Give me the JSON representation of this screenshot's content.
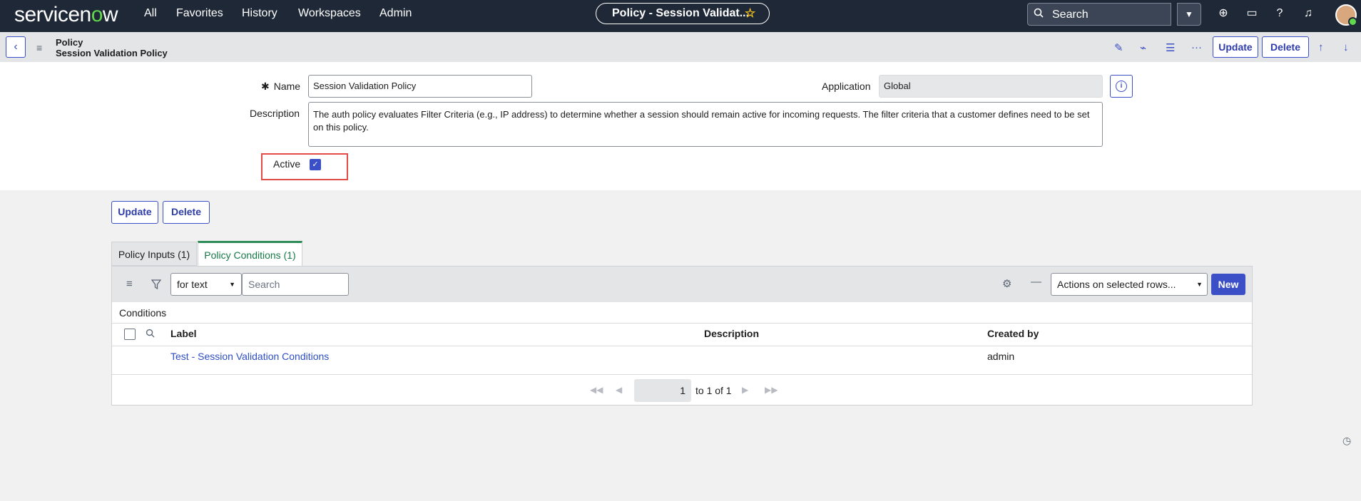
{
  "nav": {
    "logo_pre": "servicen",
    "logo_o": "o",
    "logo_post": "w",
    "links": [
      "All",
      "Favorites",
      "History",
      "Workspaces",
      "Admin"
    ],
    "page_pill": "Policy - Session Validat...",
    "search_placeholder": "Search"
  },
  "header": {
    "table": "Policy",
    "record": "Session Validation Policy",
    "update_label": "Update",
    "delete_label": "Delete"
  },
  "form": {
    "name_label": "Name",
    "name_value": "Session Validation Policy",
    "application_label": "Application",
    "application_value": "Global",
    "description_label": "Description",
    "description_value": "The auth policy evaluates Filter Criteria (e.g., IP address) to determine whether a session should remain active for incoming requests.  The filter criteria that a customer defines need to be set on this policy.",
    "active_label": "Active",
    "active_checked": true
  },
  "bottom_buttons": {
    "update": "Update",
    "delete": "Delete"
  },
  "tabs": [
    {
      "label": "Policy Inputs (1)",
      "active": false
    },
    {
      "label": "Policy Conditions (1)",
      "active": true
    }
  ],
  "list": {
    "search_field": "for text",
    "search_placeholder": "Search",
    "actions_select": "Actions on selected rows...",
    "new_label": "New",
    "title": "Conditions",
    "columns": [
      "Label",
      "Description",
      "Created by"
    ],
    "rows": [
      {
        "label": "Test - Session Validation Conditions",
        "description": "",
        "created_by": "admin"
      }
    ],
    "pager": {
      "current": "1",
      "range_text": "to 1 of 1"
    }
  },
  "colors": {
    "brand": "#1f2837",
    "accent": "#3b4fc6",
    "tab_active": "#2e8a57",
    "highlight": "#e34b46"
  }
}
